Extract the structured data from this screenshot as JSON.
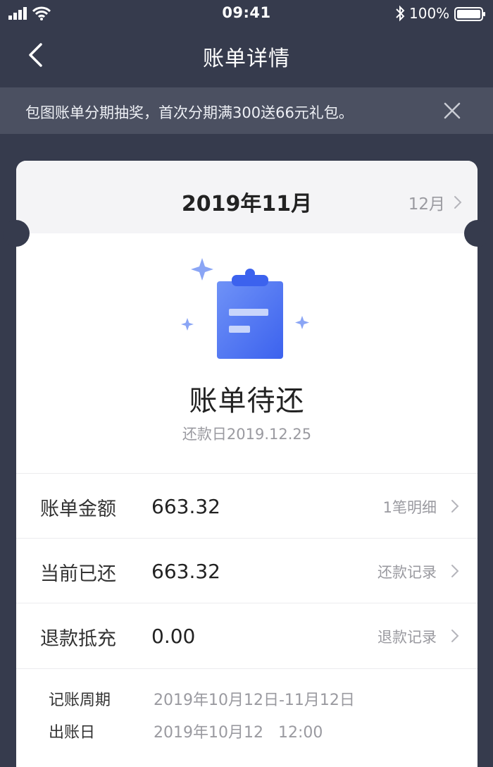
{
  "status_bar": {
    "time": "09:41",
    "battery": "100%",
    "icons": [
      "signal-icon",
      "wifi-icon",
      "bluetooth-icon",
      "battery-icon"
    ]
  },
  "nav": {
    "title": "账单详情",
    "back_icon": "back-icon"
  },
  "promo": {
    "text": "包图账单分期抽奖，首次分期满300送66元礼包。",
    "close_icon": "close-icon"
  },
  "bill": {
    "month": "2019年11月",
    "next_month": "12月",
    "status": "账单待还",
    "due_date": "还款日2019.12.25",
    "icon": "clipboard-icon"
  },
  "rows": [
    {
      "label": "账单金额",
      "value": "663.32",
      "link": "1笔明细"
    },
    {
      "label": "当前已还",
      "value": "663.32",
      "link": "还款记录"
    },
    {
      "label": "退款抵充",
      "value": "0.00",
      "link": "退款记录"
    }
  ],
  "info": [
    {
      "label": "记账周期",
      "value": "2019年10月12日-11月12日"
    },
    {
      "label": "出账日",
      "value": "2019年10月12   12:00"
    }
  ],
  "colors": {
    "background": "#363b4d",
    "banner": "#4b5061",
    "accent_blue": "#4a73f2",
    "card": "#ffffff"
  }
}
